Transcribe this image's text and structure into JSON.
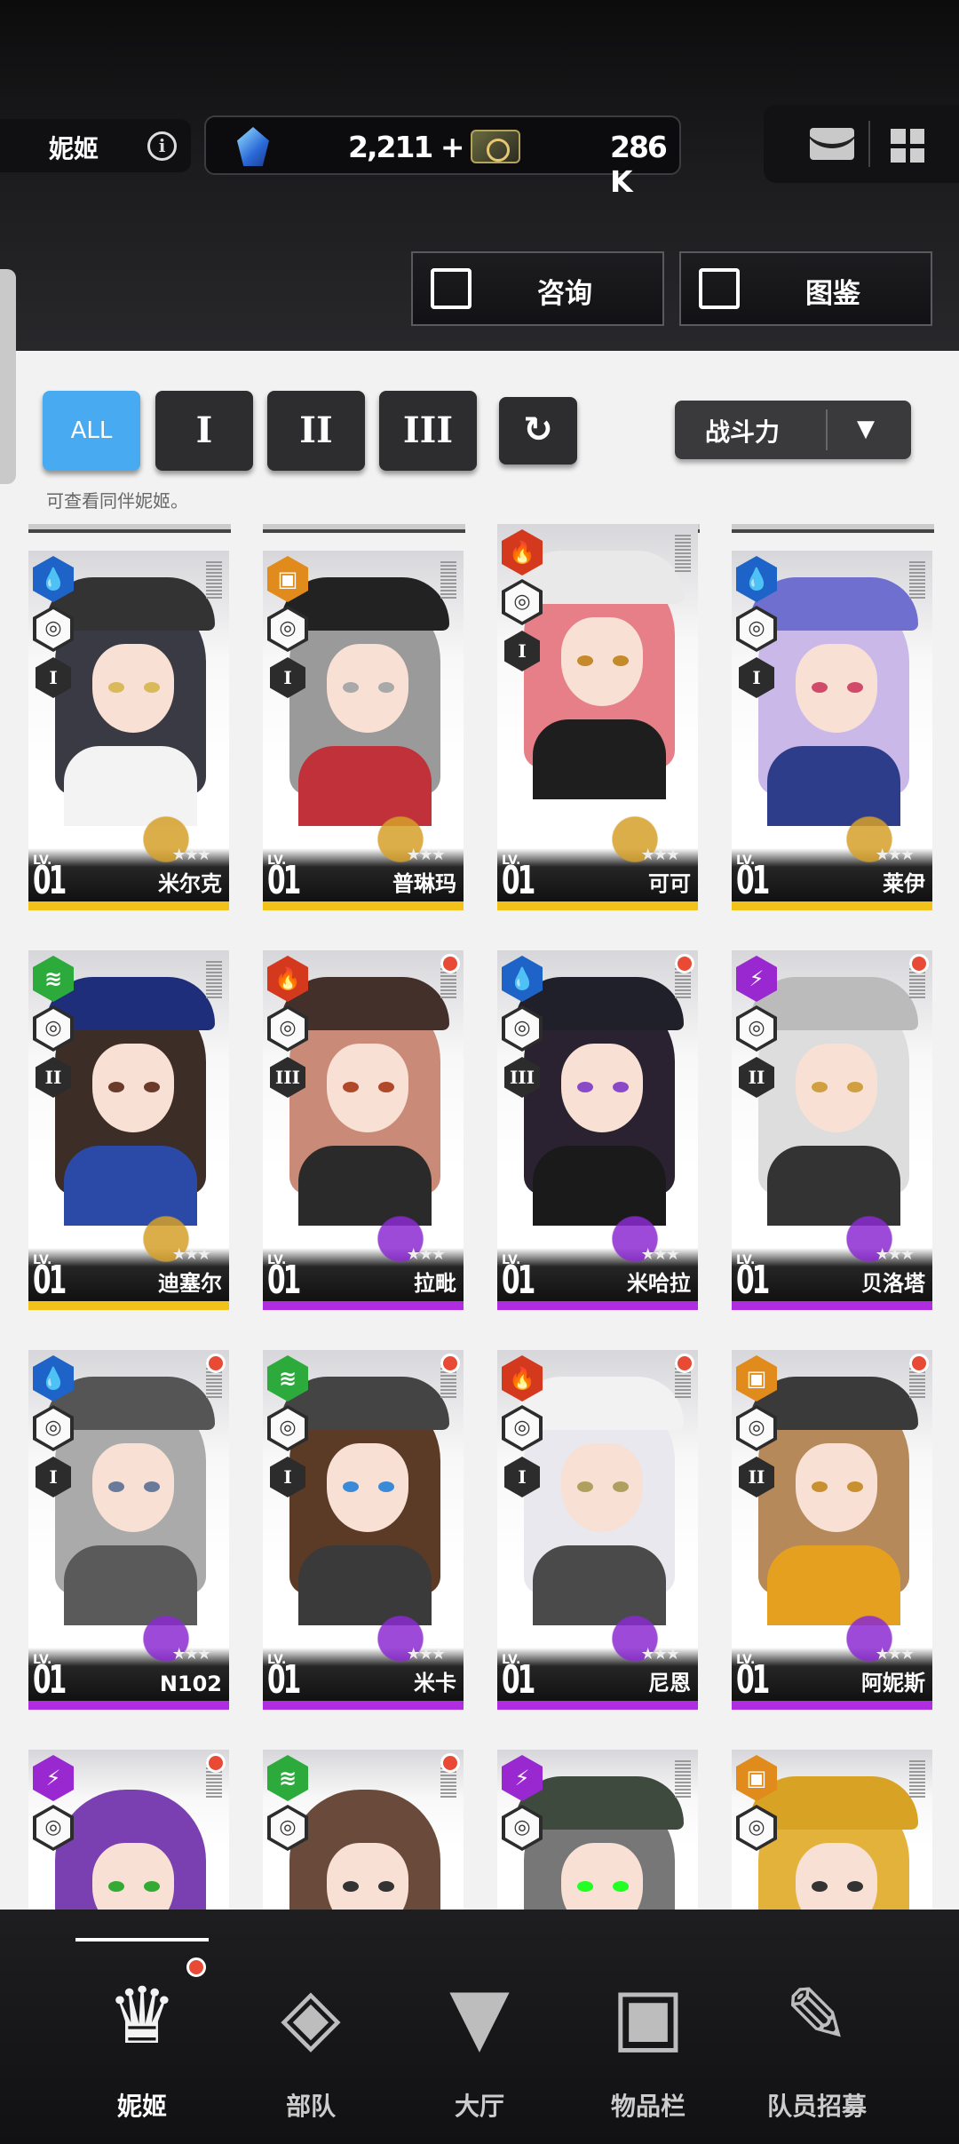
{
  "header": {
    "player_name": "妮姬",
    "info_icon": "info-icon",
    "currency_gems": "2,211",
    "gems_plus": "+",
    "currency_credits": "286 K",
    "consult_label": "咨询",
    "codex_label": "图鉴"
  },
  "filters": {
    "all_label": "ALL",
    "tier1_label": "I",
    "tier2_label": "II",
    "tier3_label": "III",
    "sort_label": "战斗力",
    "hint": "可查看同伴妮姬。"
  },
  "colors": {
    "accent_blue": "#48aaf0",
    "strip_yellow": "#f2c21a",
    "strip_purple": "#b02ce0",
    "badge_red": "#e84a35"
  },
  "cards": [
    {
      "name": "米尔克",
      "lv_label": "LV.",
      "level": "01",
      "element": "water",
      "tier": "I",
      "rarity": "SR",
      "new": false
    },
    {
      "name": "普琳玛",
      "lv_label": "LV.",
      "level": "01",
      "element": "iron",
      "tier": "I",
      "rarity": "SR",
      "new": false
    },
    {
      "name": "可可",
      "lv_label": "LV.",
      "level": "01",
      "element": "fire",
      "tier": "I",
      "rarity": "SR",
      "new": false
    },
    {
      "name": "莱伊",
      "lv_label": "LV.",
      "level": "01",
      "element": "water",
      "tier": "I",
      "rarity": "SR",
      "new": false
    },
    {
      "name": "迪塞尔",
      "lv_label": "LV.",
      "level": "01",
      "element": "wind",
      "tier": "II",
      "rarity": "SR",
      "new": false
    },
    {
      "name": "拉毗",
      "lv_label": "LV.",
      "level": "01",
      "element": "fire",
      "tier": "III",
      "rarity": "SSR",
      "new": true
    },
    {
      "name": "米哈拉",
      "lv_label": "LV.",
      "level": "01",
      "element": "water",
      "tier": "III",
      "rarity": "SSR",
      "new": true
    },
    {
      "name": "贝洛塔",
      "lv_label": "LV.",
      "level": "01",
      "element": "electric",
      "tier": "II",
      "rarity": "SSR",
      "new": true
    },
    {
      "name": "N102",
      "lv_label": "LV.",
      "level": "01",
      "element": "water",
      "tier": "I",
      "rarity": "SSR",
      "new": true
    },
    {
      "name": "米卡",
      "lv_label": "LV.",
      "level": "01",
      "element": "wind",
      "tier": "I",
      "rarity": "SSR",
      "new": true
    },
    {
      "name": "尼恩",
      "lv_label": "LV.",
      "level": "01",
      "element": "fire",
      "tier": "I",
      "rarity": "SSR",
      "new": true
    },
    {
      "name": "阿妮斯",
      "lv_label": "LV.",
      "level": "01",
      "element": "iron",
      "tier": "II",
      "rarity": "SSR",
      "new": true
    },
    {
      "name": "",
      "element": "electric",
      "new": true
    },
    {
      "name": "",
      "element": "wind",
      "new": true
    },
    {
      "name": "",
      "element": "electric",
      "new": false
    },
    {
      "name": "",
      "element": "iron",
      "new": false
    }
  ],
  "nav": [
    {
      "label": "妮姬",
      "icon": "nikke-icon",
      "active": true,
      "badge": true
    },
    {
      "label": "部队",
      "icon": "squad-icon",
      "active": false,
      "badge": false
    },
    {
      "label": "大厅",
      "icon": "lobby-icon",
      "active": false,
      "badge": false
    },
    {
      "label": "物品栏",
      "icon": "inventory-icon",
      "active": false,
      "badge": false
    },
    {
      "label": "队员招募",
      "icon": "recruit-icon",
      "active": false,
      "badge": false
    }
  ]
}
